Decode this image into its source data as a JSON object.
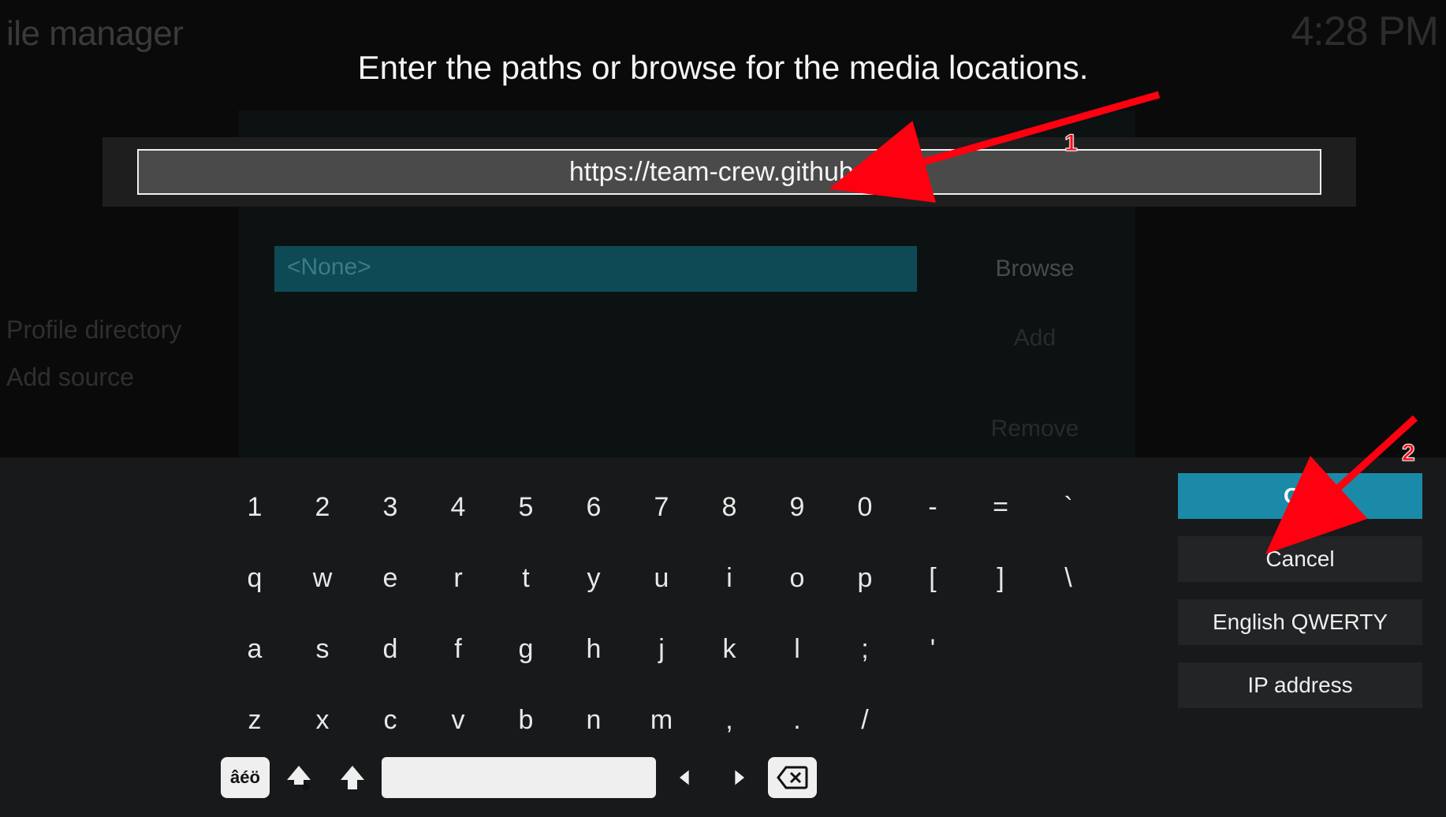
{
  "bg": {
    "header_title": "ile manager",
    "clock": "4:28 PM",
    "profile_dir": "Profile directory",
    "add_source": "Add source"
  },
  "underlying_dialog": {
    "none_placeholder": "<None>",
    "browse": "Browse",
    "add": "Add",
    "remove": "Remove"
  },
  "dialog": {
    "prompt": "Enter the paths or browse for the media locations.",
    "input_value": "https://team-crew.github.io/"
  },
  "keyboard": {
    "rows": [
      [
        "1",
        "2",
        "3",
        "4",
        "5",
        "6",
        "7",
        "8",
        "9",
        "0",
        "-",
        "=",
        "`"
      ],
      [
        "q",
        "w",
        "e",
        "r",
        "t",
        "y",
        "u",
        "i",
        "o",
        "p",
        "[",
        "]",
        "\\"
      ],
      [
        "a",
        "s",
        "d",
        "f",
        "g",
        "h",
        "j",
        "k",
        "l",
        ";",
        "'"
      ],
      [
        "z",
        "x",
        "c",
        "v",
        "b",
        "n",
        "m",
        ",",
        ".",
        "/"
      ]
    ],
    "accent_label": "âéö"
  },
  "side_buttons": {
    "ok": "OK",
    "cancel": "Cancel",
    "layout": "English QWERTY",
    "ip": "IP address"
  },
  "annotations": {
    "one": "1",
    "two": "2"
  }
}
